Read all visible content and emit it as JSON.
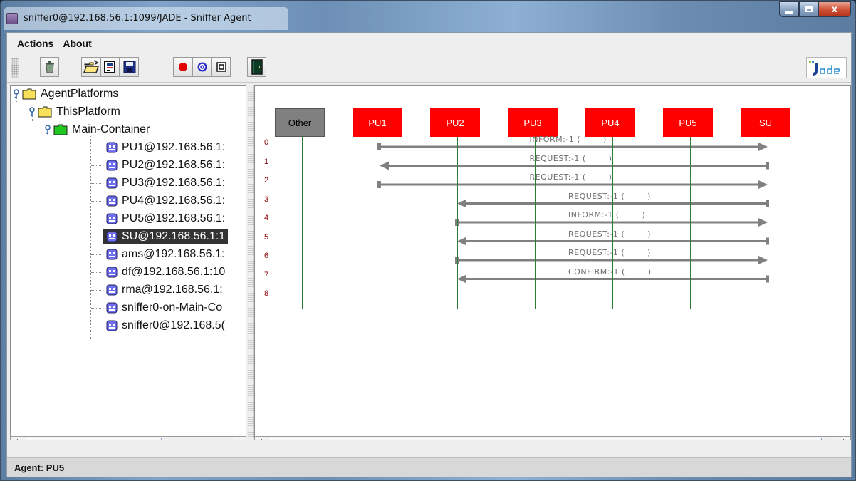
{
  "window": {
    "title": "sniffer0@192.168.56.1:1099/JADE - Sniffer Agent",
    "controls": {
      "minimize": "minimize",
      "maximize": "maximize",
      "close": "x"
    }
  },
  "menu": {
    "items": [
      "Actions",
      "About"
    ]
  },
  "toolbar": {
    "buttons": [
      {
        "icon": "trash-icon",
        "label": "Clear canvas"
      },
      {
        "icon": "open-folder-icon",
        "label": "Open snapshot"
      },
      {
        "icon": "open-file-icon",
        "label": "Open messages"
      },
      {
        "icon": "save-icon",
        "label": "Save"
      },
      {
        "icon": "record-icon",
        "label": "Record"
      },
      {
        "icon": "sniff-icon",
        "label": "Sniff"
      },
      {
        "icon": "stop-icon",
        "label": "Stop"
      },
      {
        "icon": "exit-icon",
        "label": "Exit"
      }
    ],
    "logo": "Jade"
  },
  "tree": {
    "root": "AgentPlatforms",
    "platform": "ThisPlatform",
    "container": "Main-Container",
    "agents": [
      "PU1@192.168.56.1:",
      "PU2@192.168.56.1:",
      "PU3@192.168.56.1:",
      "PU4@192.168.56.1:",
      "PU5@192.168.56.1:",
      "SU@192.168.56.1:1",
      "ams@192.168.56.1:",
      "df@192.168.56.1:10",
      "rma@192.168.56.1:",
      "sniffer0-on-Main-Co",
      "sniffer0@192.168.5("
    ],
    "selected_index": 5
  },
  "canvas": {
    "agents": [
      {
        "name": "Other",
        "color": "#808080",
        "text_color": "#000000"
      },
      {
        "name": "PU1",
        "color": "#ff0000",
        "text_color": "#ffffff"
      },
      {
        "name": "PU2",
        "color": "#ff0000",
        "text_color": "#ffffff"
      },
      {
        "name": "PU3",
        "color": "#ff0000",
        "text_color": "#ffffff"
      },
      {
        "name": "PU4",
        "color": "#ff0000",
        "text_color": "#ffffff"
      },
      {
        "name": "PU5",
        "color": "#ff0000",
        "text_color": "#ffffff"
      },
      {
        "name": "SU",
        "color": "#ff0000",
        "text_color": "#ffffff"
      }
    ],
    "row_numbers": [
      "0",
      "1",
      "2",
      "3",
      "4",
      "5",
      "6",
      "7",
      "8"
    ],
    "messages": [
      {
        "row": 1,
        "label": "INFORM:-1 (        )",
        "from": "PU1",
        "to": "SU"
      },
      {
        "row": 2,
        "label": "REQUEST:-1 (        )",
        "from": "SU",
        "to": "PU1"
      },
      {
        "row": 3,
        "label": "REQUEST:-1 (        )",
        "from": "PU1",
        "to": "SU"
      },
      {
        "row": 4,
        "label": "REQUEST:-1 (        )",
        "from": "SU",
        "to": "PU2"
      },
      {
        "row": 5,
        "label": "INFORM:-1 (        )",
        "from": "PU2",
        "to": "SU"
      },
      {
        "row": 6,
        "label": "REQUEST:-1 (        )",
        "from": "SU",
        "to": "PU2"
      },
      {
        "row": 7,
        "label": "REQUEST:-1 (        )",
        "from": "PU2",
        "to": "SU"
      },
      {
        "row": 8,
        "label": "CONFIRM:-1 (        )",
        "from": "SU",
        "to": "PU2"
      }
    ],
    "lifeline_color": "#2e7d32",
    "arrow_color": "#808080",
    "row_number_color": "#8a0000"
  },
  "status": {
    "text": "Agent: PU5"
  }
}
